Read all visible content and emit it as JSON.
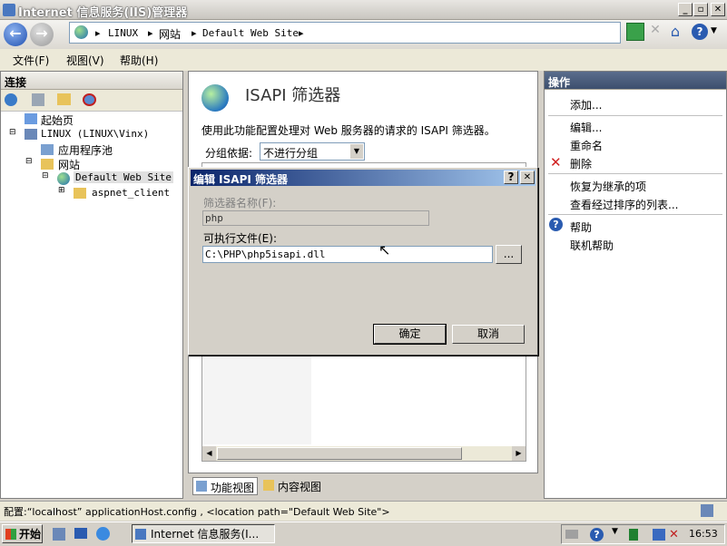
{
  "window": {
    "title": "Internet 信息服务(IIS)管理器"
  },
  "address": {
    "segments": [
      "LINUX",
      "网站",
      "Default Web Site"
    ]
  },
  "menu": {
    "file": "文件(F)",
    "view": "视图(V)",
    "help": "帮助(H)"
  },
  "connections": {
    "header": "连接",
    "tree": [
      "起始页",
      "LINUX (LINUX\\Vinx)",
      "应用程序池",
      "网站",
      "Default Web Site",
      "aspnet_client"
    ]
  },
  "main": {
    "title": "ISAPI 筛选器",
    "description": "使用此功能配置处理对 Web 服务器的请求的 ISAPI 筛选器。",
    "group_label": "分组依据:",
    "group_value": "不进行分组",
    "tab_features": "功能视图",
    "tab_content": "内容视图"
  },
  "actions": {
    "header": "操作",
    "add": "添加...",
    "edit": "编辑...",
    "rename": "重命名",
    "delete": "删除",
    "revert": "恢复为继承的项",
    "view_ordered": "查看经过排序的列表...",
    "help": "帮助",
    "online_help": "联机帮助"
  },
  "dialog": {
    "title": "编辑 ISAPI 筛选器",
    "name_label": "筛选器名称(F):",
    "name_value": "php",
    "exe_label": "可执行文件(E):",
    "exe_value": "C:\\PHP\\php5isapi.dll",
    "browse": "...",
    "ok": "确定",
    "cancel": "取消",
    "help_btn": "?",
    "close_btn": "✕"
  },
  "status": {
    "text": "配置:“localhost” applicationHost.config , <location path=\"Default Web Site\">"
  },
  "taskbar": {
    "start": "开始",
    "task": "Internet 信息服务(I...",
    "clock": "16:53"
  }
}
